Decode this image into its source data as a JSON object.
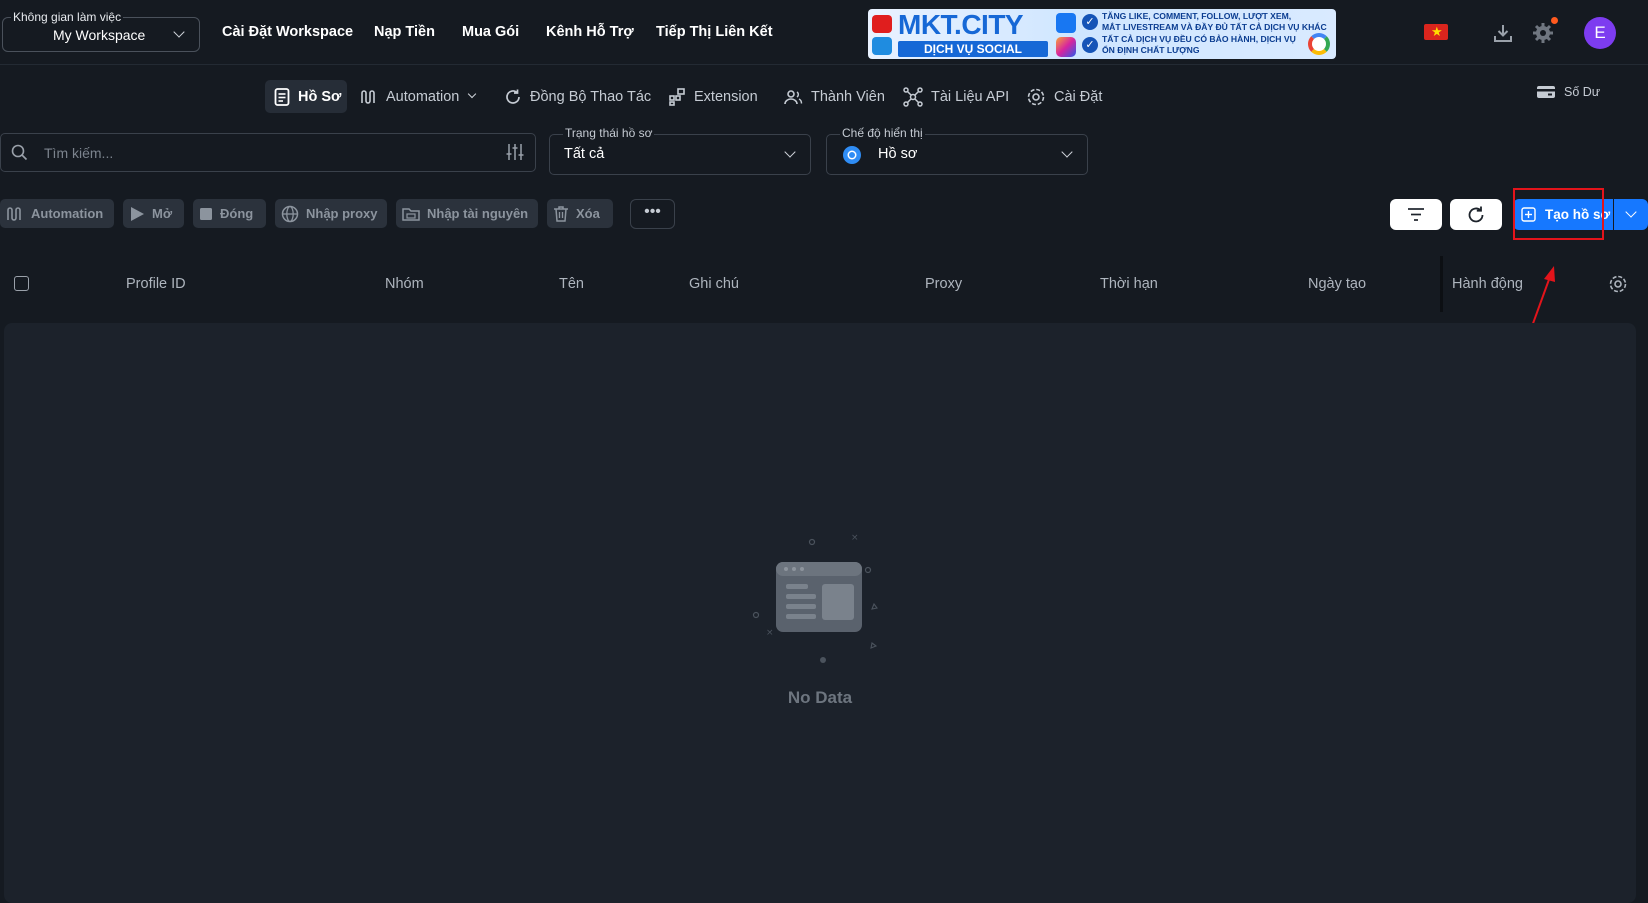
{
  "workspace": {
    "label": "Không gian làm việc",
    "value": "My Workspace"
  },
  "top_nav": [
    "Cài Đặt Workspace",
    "Nạp Tiền",
    "Mua Gói",
    "Kênh Hỗ Trợ",
    "Tiếp Thị Liên Kết"
  ],
  "banner": {
    "brand": "MKT.CITY",
    "tagline": "DỊCH VỤ SOCIAL",
    "lines": [
      "TĂNG LIKE, COMMENT, FOLLOW, LƯỢT XEM,",
      "MẮT LIVESTREAM VÀ ĐẦY ĐỦ TẤT CẢ DỊCH VỤ KHÁC",
      "TẤT CẢ DỊCH VỤ ĐỀU CÓ BẢO HÀNH, DỊCH VỤ",
      "ỔN ĐỊNH CHẤT LƯỢNG"
    ]
  },
  "user": {
    "avatar_letter": "E"
  },
  "tabs": {
    "profile": "Hồ Sơ",
    "automation": "Automation",
    "sync": "Đồng Bộ Thao Tác",
    "extension": "Extension",
    "members": "Thành Viên",
    "api_docs": "Tài Liệu API",
    "settings": "Cài Đặt"
  },
  "balance_label": "Số Dư",
  "search": {
    "placeholder": "Tìm kiếm..."
  },
  "status_filter": {
    "label": "Trạng thái hồ sơ",
    "value": "Tất cả"
  },
  "display_mode": {
    "label": "Chế độ hiển thị",
    "value": "Hồ sơ"
  },
  "actions": {
    "automation": "Automation",
    "open": "Mở",
    "close": "Đóng",
    "import_proxy": "Nhập proxy",
    "import_resource": "Nhập tài nguyên",
    "delete": "Xóa",
    "more": "•••"
  },
  "create_button": "Tạo hồ sơ",
  "table": {
    "columns": [
      "Profile ID",
      "Nhóm",
      "Tên",
      "Ghi chú",
      "Proxy",
      "Thời hạn",
      "Ngày tạo",
      "Hành động"
    ],
    "rows": [],
    "empty_text": "No Data"
  },
  "colors": {
    "accent": "#1678ff",
    "background": "#151a21",
    "highlight_annotation": "#e3141b",
    "avatar": "#7d3cf0"
  }
}
